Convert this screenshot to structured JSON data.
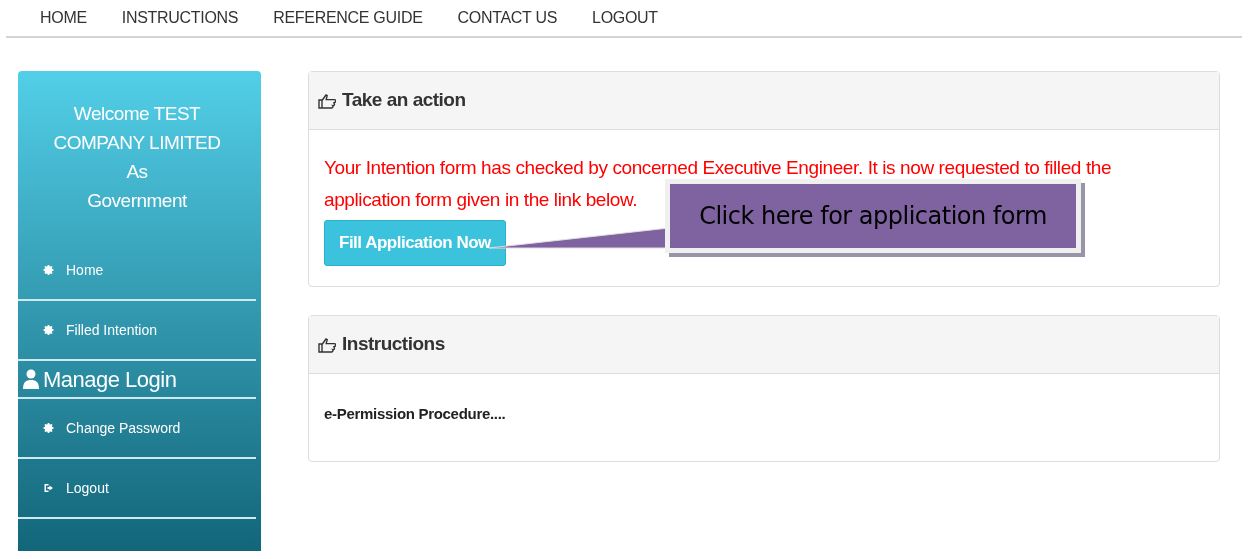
{
  "nav": {
    "items": [
      {
        "label": "HOME"
      },
      {
        "label": "INSTRUCTIONS"
      },
      {
        "label": "REFERENCE GUIDE"
      },
      {
        "label": "CONTACT US"
      },
      {
        "label": "LOGOUT"
      }
    ]
  },
  "sidebar": {
    "welcome": [
      "Welcome TEST",
      "COMPANY LIMITED",
      "As",
      "Government"
    ],
    "items": [
      {
        "kind": "link",
        "label": "Home"
      },
      {
        "kind": "link",
        "label": "Filled Intention"
      },
      {
        "kind": "heading",
        "label": "Manage Login"
      },
      {
        "kind": "link",
        "label": "Change Password"
      },
      {
        "kind": "exit",
        "label": "Logout"
      }
    ]
  },
  "action_panel": {
    "title": "Take an action",
    "message": [
      "Your Intention form has checked by concerned Executive Engineer. It is now requested to filled the",
      "application form given in the link below."
    ],
    "button": "Fill Application Now",
    "callout": "Click here for application form"
  },
  "instructions_panel": {
    "title": "Instructions",
    "body": "e-Permission Procedure...."
  }
}
